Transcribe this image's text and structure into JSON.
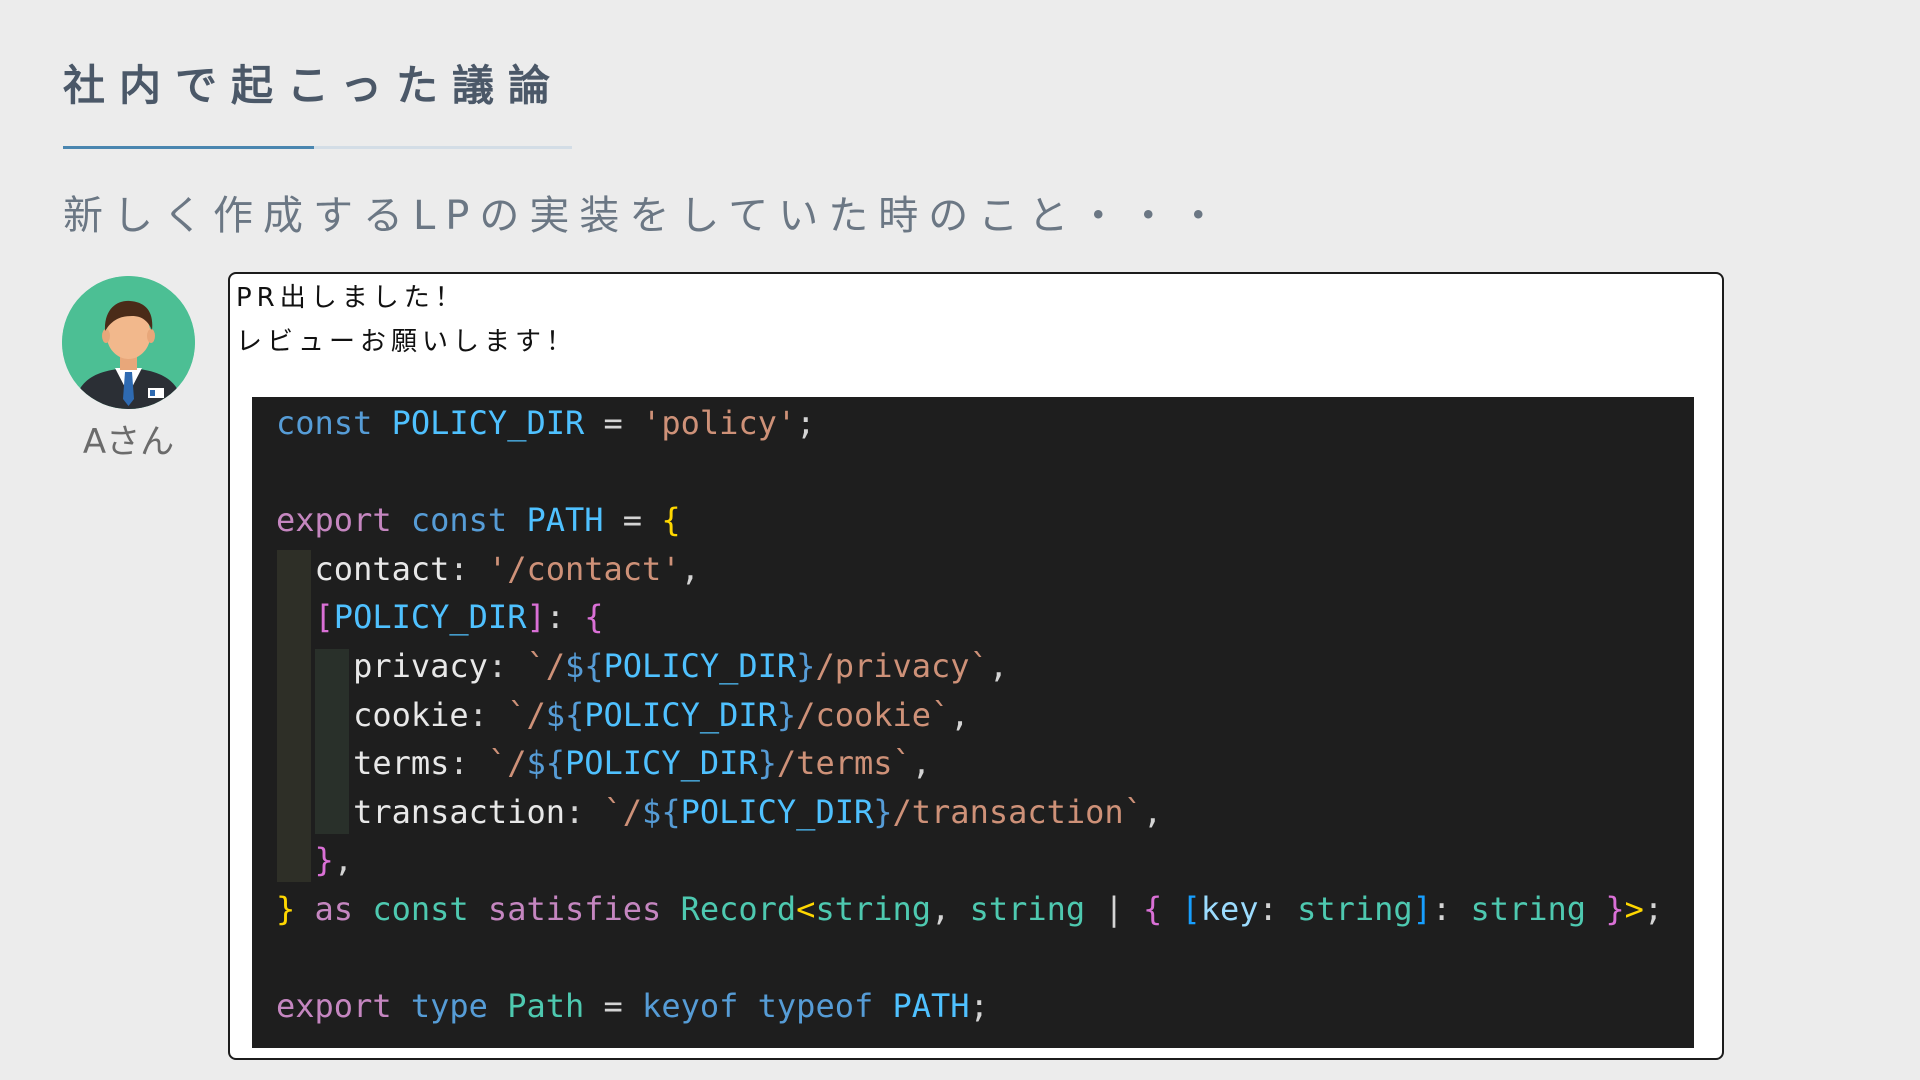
{
  "slide": {
    "title": "社内で起こった議論",
    "subtitle": "新しく作成するLPの実装をしていた時のこと・・・"
  },
  "user": {
    "name": "Aさん",
    "avatar_icon": "businessman-avatar-icon"
  },
  "message": {
    "line1": "PR出しました！",
    "line2": "レビューお願いします！"
  },
  "code": {
    "language": "typescript",
    "lines": [
      [
        {
          "t": "const",
          "c": "kw-blue"
        },
        {
          "t": " ",
          "c": "punc"
        },
        {
          "t": "POLICY_DIR",
          "c": "var"
        },
        {
          "t": " = ",
          "c": "punc"
        },
        {
          "t": "'policy'",
          "c": "str"
        },
        {
          "t": ";",
          "c": "punc"
        }
      ],
      [],
      [
        {
          "t": "export",
          "c": "kw-purple"
        },
        {
          "t": " ",
          "c": "punc"
        },
        {
          "t": "const",
          "c": "kw-blue"
        },
        {
          "t": " ",
          "c": "punc"
        },
        {
          "t": "PATH",
          "c": "var"
        },
        {
          "t": " = ",
          "c": "punc"
        },
        {
          "t": "{",
          "c": "br1"
        }
      ],
      [
        {
          "t": "  ",
          "c": "punc"
        },
        {
          "t": "contact",
          "c": "prop-w"
        },
        {
          "t": ": ",
          "c": "punc"
        },
        {
          "t": "'/contact'",
          "c": "str"
        },
        {
          "t": ",",
          "c": "punc"
        }
      ],
      [
        {
          "t": "  ",
          "c": "punc"
        },
        {
          "t": "[",
          "c": "br2"
        },
        {
          "t": "POLICY_DIR",
          "c": "var"
        },
        {
          "t": "]",
          "c": "br2"
        },
        {
          "t": ": ",
          "c": "punc"
        },
        {
          "t": "{",
          "c": "br2"
        }
      ],
      [
        {
          "t": "    ",
          "c": "punc"
        },
        {
          "t": "privacy",
          "c": "prop-w"
        },
        {
          "t": ": ",
          "c": "punc"
        },
        {
          "t": "`/",
          "c": "str"
        },
        {
          "t": "${",
          "c": "tmpl"
        },
        {
          "t": "POLICY_DIR",
          "c": "var"
        },
        {
          "t": "}",
          "c": "tmpl"
        },
        {
          "t": "/privacy`",
          "c": "str"
        },
        {
          "t": ",",
          "c": "punc"
        }
      ],
      [
        {
          "t": "    ",
          "c": "punc"
        },
        {
          "t": "cookie",
          "c": "prop-w"
        },
        {
          "t": ": ",
          "c": "punc"
        },
        {
          "t": "`/",
          "c": "str"
        },
        {
          "t": "${",
          "c": "tmpl"
        },
        {
          "t": "POLICY_DIR",
          "c": "var"
        },
        {
          "t": "}",
          "c": "tmpl"
        },
        {
          "t": "/cookie`",
          "c": "str"
        },
        {
          "t": ",",
          "c": "punc"
        }
      ],
      [
        {
          "t": "    ",
          "c": "punc"
        },
        {
          "t": "terms",
          "c": "prop-w"
        },
        {
          "t": ": ",
          "c": "punc"
        },
        {
          "t": "`/",
          "c": "str"
        },
        {
          "t": "${",
          "c": "tmpl"
        },
        {
          "t": "POLICY_DIR",
          "c": "var"
        },
        {
          "t": "}",
          "c": "tmpl"
        },
        {
          "t": "/terms`",
          "c": "str"
        },
        {
          "t": ",",
          "c": "punc"
        }
      ],
      [
        {
          "t": "    ",
          "c": "punc"
        },
        {
          "t": "transaction",
          "c": "prop-w"
        },
        {
          "t": ": ",
          "c": "punc"
        },
        {
          "t": "`/",
          "c": "str"
        },
        {
          "t": "${",
          "c": "tmpl"
        },
        {
          "t": "POLICY_DIR",
          "c": "var"
        },
        {
          "t": "}",
          "c": "tmpl"
        },
        {
          "t": "/transaction`",
          "c": "str"
        },
        {
          "t": ",",
          "c": "punc"
        }
      ],
      [
        {
          "t": "  ",
          "c": "punc"
        },
        {
          "t": "}",
          "c": "br2"
        },
        {
          "t": ",",
          "c": "punc"
        }
      ],
      [
        {
          "t": "}",
          "c": "br1"
        },
        {
          "t": " ",
          "c": "punc"
        },
        {
          "t": "as",
          "c": "kw-purple"
        },
        {
          "t": " ",
          "c": "punc"
        },
        {
          "t": "const",
          "c": "type"
        },
        {
          "t": " ",
          "c": "punc"
        },
        {
          "t": "satisfies",
          "c": "kw-purple"
        },
        {
          "t": " ",
          "c": "punc"
        },
        {
          "t": "Record",
          "c": "type"
        },
        {
          "t": "<",
          "c": "br1"
        },
        {
          "t": "string",
          "c": "type"
        },
        {
          "t": ", ",
          "c": "punc"
        },
        {
          "t": "string",
          "c": "type"
        },
        {
          "t": " | ",
          "c": "punc"
        },
        {
          "t": "{",
          "c": "br2"
        },
        {
          "t": " ",
          "c": "punc"
        },
        {
          "t": "[",
          "c": "br3"
        },
        {
          "t": "key",
          "c": "prop"
        },
        {
          "t": ": ",
          "c": "punc"
        },
        {
          "t": "string",
          "c": "type"
        },
        {
          "t": "]",
          "c": "br3"
        },
        {
          "t": ": ",
          "c": "punc"
        },
        {
          "t": "string",
          "c": "type"
        },
        {
          "t": " ",
          "c": "punc"
        },
        {
          "t": "}",
          "c": "br2"
        },
        {
          "t": ">",
          "c": "br1"
        },
        {
          "t": ";",
          "c": "punc"
        }
      ],
      [],
      [
        {
          "t": "export",
          "c": "kw-purple"
        },
        {
          "t": " ",
          "c": "punc"
        },
        {
          "t": "type",
          "c": "kw-blue"
        },
        {
          "t": " ",
          "c": "punc"
        },
        {
          "t": "Path",
          "c": "type"
        },
        {
          "t": " = ",
          "c": "punc"
        },
        {
          "t": "keyof",
          "c": "kw-blue"
        },
        {
          "t": " ",
          "c": "punc"
        },
        {
          "t": "typeof",
          "c": "kw-blue"
        },
        {
          "t": " ",
          "c": "punc"
        },
        {
          "t": "PATH",
          "c": "var"
        },
        {
          "t": ";",
          "c": "punc"
        }
      ]
    ]
  }
}
